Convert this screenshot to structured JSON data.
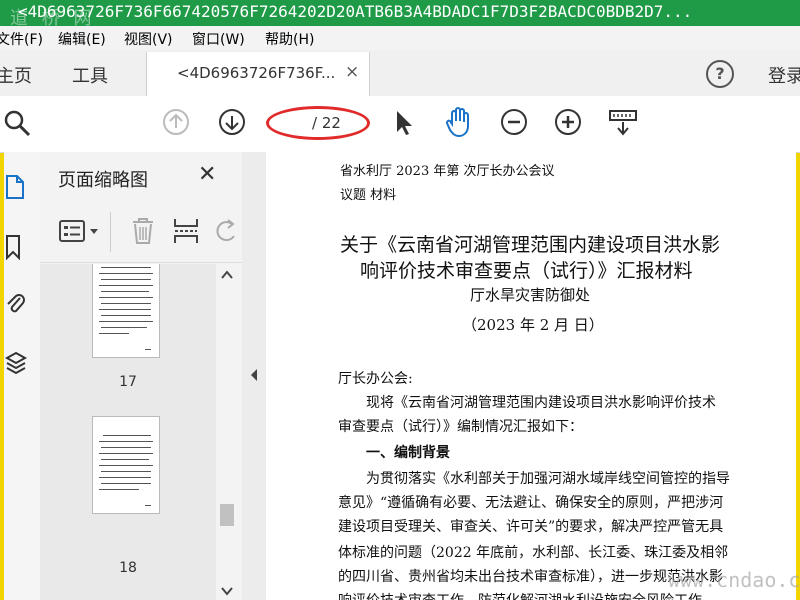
{
  "window": {
    "title": "<4D6963726F736F667420576F7264202D20ATB6B3A4BDADC1F7D3F2BACDC0BDB2D7...",
    "watermark_top": "道 桥 网"
  },
  "menu": [
    "文件(F)",
    "编辑(E)",
    "视图(V)",
    "窗口(W)",
    "帮助(H)"
  ],
  "tabs": {
    "home": "主页",
    "tools": "工具",
    "document": "<4D6963726F736F...",
    "close": "×",
    "help": "?",
    "login": "登录"
  },
  "toolbar": {
    "current_page": "",
    "total_pages": "/ 22"
  },
  "panel": {
    "title": "页面缩略图",
    "close": "✕",
    "pages": [
      "17",
      "18"
    ]
  },
  "document": {
    "header1": "省水利厅 2023 年第  次厅长办公会议",
    "header2": "议题  材料",
    "title1": "关于《云南省河湖管理范围内建设项目洪水影",
    "title2": "响评价技术审查要点（试行）》汇报材料",
    "dept": "厅水旱灾害防御处",
    "date": "（2023 年 2 月  日）",
    "salutation": "厅长办公会:",
    "para1a": "现将《云南省河湖管理范围内建设项目洪水影响评价技术",
    "para1b": "审查要点（试行）》编制情况汇报如下：",
    "section1": "一、编制背景",
    "para2a": "为贯彻落实《水利部关于加强河湖水域岸线空间管控的指导",
    "para2b": "意见》“遵循确有必要、无法避让、确保安全的原则，严把涉河",
    "para2c": "建设项目受理关、审查关、许可关”的要求，解决严控严管无具",
    "para2d": "体标准的问题（2022 年底前，水利部、长江委、珠江委及相邻",
    "para2e": "的四川省、贵州省均未出台技术审查标准），进一步规范洪水影",
    "para2f": "响评价技术审查工作，防范化解河湖水利设施安全风险工作"
  },
  "watermark_bottom": "www.cndao.com"
}
